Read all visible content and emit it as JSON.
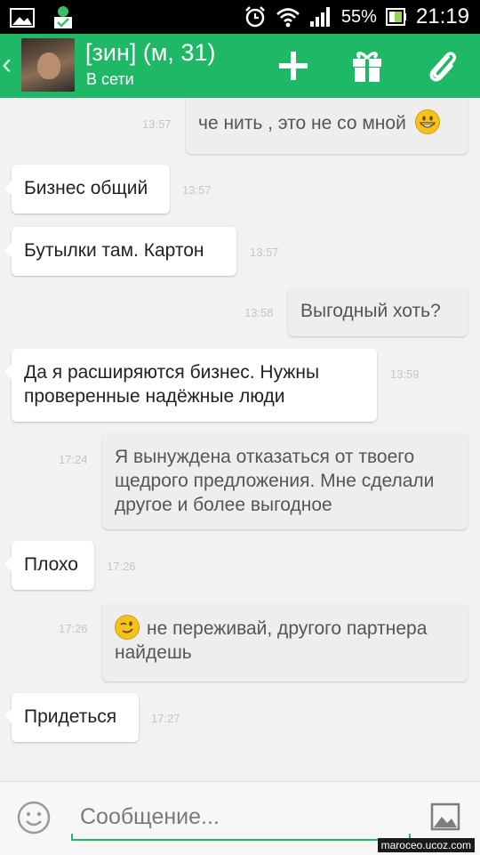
{
  "status_bar": {
    "battery_percent": "55%",
    "time": "21:19"
  },
  "header": {
    "back_icon": "chevron-left-icon",
    "contact_name": "[зин] (м, 31)",
    "contact_status": "В сети",
    "actions": [
      "plus-icon",
      "gift-icon",
      "paperclip-icon"
    ],
    "accent_color": "#1fb866"
  },
  "messages": [
    {
      "direction": "out",
      "text": "че нить , это не со мной",
      "emoji": "grinning-emoji",
      "time": "13:57"
    },
    {
      "direction": "in",
      "text": "Бизнес общий",
      "time": "13:57"
    },
    {
      "direction": "in",
      "text": "Бутылки там. Картон",
      "time": "13:57"
    },
    {
      "direction": "out",
      "text": "Выгодный хоть?",
      "time": "13:58"
    },
    {
      "direction": "in",
      "text": "Да я расширяются бизнес. Нужны проверенные надёжные люди",
      "time": "13:59"
    },
    {
      "direction": "out",
      "text": "Я вынуждена отказаться от твоего щедрого предложения. Мне сделали другое и более выгодное",
      "time": "17:24"
    },
    {
      "direction": "in",
      "text": "Плохо",
      "time": "17:26"
    },
    {
      "direction": "out",
      "text": "не переживай,  другого партнера найдешь",
      "emoji": "winking-emoji",
      "time": "17:26"
    },
    {
      "direction": "in",
      "text": "Придеться",
      "time": "17:27"
    }
  ],
  "input": {
    "placeholder": "Сообщение..."
  },
  "watermark": "maroceo.ucoz.com"
}
